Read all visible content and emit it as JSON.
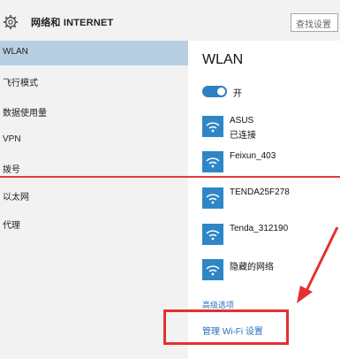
{
  "window": {
    "title": "网络和 INTERNET",
    "search_placeholder": "查找设置",
    "title_icon": "gear-icon"
  },
  "sidebar": {
    "items": [
      {
        "label": "WLAN",
        "active": true
      },
      {
        "label": "飞行模式",
        "active": false
      },
      {
        "label": "数据使用量",
        "active": false
      },
      {
        "label": "VPN",
        "active": false
      },
      {
        "label": "拨号",
        "active": false
      },
      {
        "label": "以太网",
        "active": false
      },
      {
        "label": "代理",
        "active": false
      }
    ]
  },
  "main": {
    "title": "WLAN",
    "toggle": {
      "state": "on",
      "label": "开"
    },
    "networks": [
      {
        "name": "ASUS",
        "status": "已连接",
        "icon": "wifi-icon"
      },
      {
        "name": "Feixun_403",
        "status": "",
        "icon": "wifi-icon"
      },
      {
        "name": "TENDA25F278",
        "status": "",
        "icon": "wifi-icon"
      },
      {
        "name": "Tenda_312190",
        "status": "",
        "icon": "wifi-icon"
      },
      {
        "name": "隐藏的网络",
        "status": "",
        "icon": "wifi-icon"
      }
    ],
    "links": {
      "advanced": "高级选项",
      "manage_wifi": "管理 Wi-Fi 设置"
    }
  },
  "colors": {
    "accent": "#2f7fc1",
    "sidebar_bg": "#f2f2f2",
    "selected_bg": "#b8cfe3",
    "link": "#2a6fbf",
    "annotation_red": "#e53030"
  }
}
